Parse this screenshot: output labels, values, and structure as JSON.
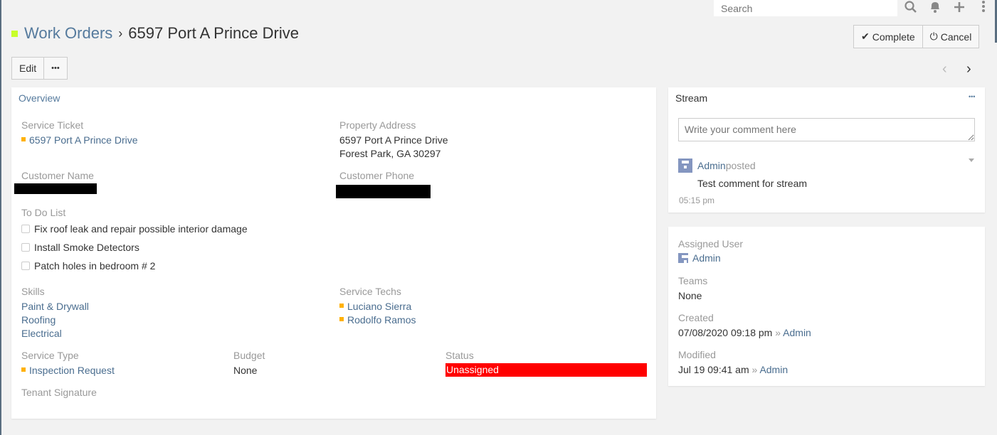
{
  "topbar": {
    "search_placeholder": "Search"
  },
  "header": {
    "breadcrumb_parent": "Work Orders",
    "separator": "›",
    "title": "6597 Port A Prince Drive",
    "complete_label": "Complete",
    "cancel_label": "Cancel",
    "edit_label": "Edit",
    "more_label": "•••"
  },
  "overview": {
    "title": "Overview",
    "service_ticket_label": "Service Ticket",
    "service_ticket": "6597 Port A Prince Drive",
    "property_address_label": "Property Address",
    "address_line1": "6597 Port A Prince Drive",
    "address_line2": "Forest Park, GA 30297",
    "customer_name_label": "Customer Name",
    "customer_phone_label": "Customer Phone",
    "todo_label": "To Do List",
    "todos": [
      "Fix roof leak and repair possible interior damage",
      "Install Smoke Detectors",
      "Patch holes in bedroom # 2"
    ],
    "skills_label": "Skills",
    "skills": [
      "Paint & Drywall",
      "Roofing",
      "Electrical"
    ],
    "techs_label": "Service Techs",
    "techs": [
      "Luciano Sierra",
      "Rodolfo Ramos"
    ],
    "service_type_label": "Service Type",
    "service_type": "Inspection Request",
    "budget_label": "Budget",
    "budget": "None",
    "status_label": "Status",
    "status": "Unassigned",
    "status_color": "#ff0000",
    "signature_label": "Tenant Signature"
  },
  "stream": {
    "title": "Stream",
    "more": "•••",
    "comment_placeholder": "Write your comment here",
    "post_user": "Admin",
    "post_action": "posted",
    "post_text": "Test comment for stream",
    "post_time": "05:15 pm"
  },
  "side": {
    "assigned_label": "Assigned User",
    "assigned": "Admin",
    "teams_label": "Teams",
    "teams": "None",
    "created_label": "Created",
    "created": "07/08/2020 09:18 pm",
    "created_sep": "»",
    "created_by": "Admin",
    "modified_label": "Modified",
    "modified": "Jul 19 09:41 am",
    "modified_sep": "»",
    "modified_by": "Admin"
  }
}
